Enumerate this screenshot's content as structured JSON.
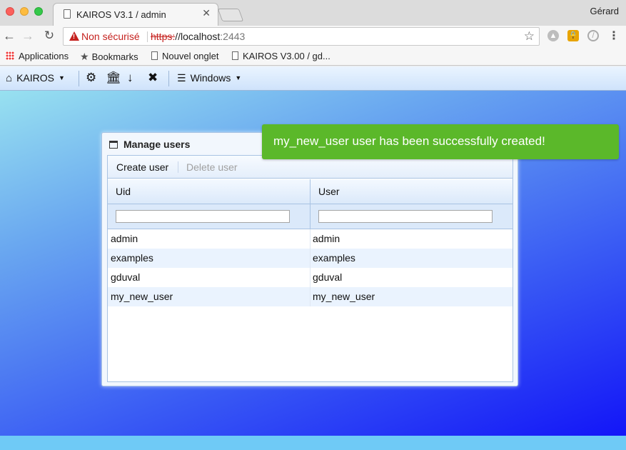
{
  "browser": {
    "tab_title": "KAIROS V3.1 / admin",
    "profile_name": "Gérard",
    "security_label": "Non sécurisé",
    "url_scheme": "https:",
    "url_host": "//localhost",
    "url_port": ":2443",
    "bookmarks": {
      "apps": "Applications",
      "bookmarks": "Bookmarks",
      "new_tab": "Nouvel onglet",
      "kairos": "KAIROS V3.00 / gd..."
    }
  },
  "app_menu": {
    "kairos_label": "KAIROS",
    "windows_label": "Windows",
    "icons": [
      "home-icon",
      "gear-icon",
      "bank-icon",
      "arrow-down-icon",
      "close-icon",
      "list-icon"
    ]
  },
  "dialog": {
    "title": "Manage users",
    "create_label": "Create user",
    "delete_label": "Delete user",
    "columns": [
      "Uid",
      "User"
    ],
    "filter_uid": "",
    "filter_user": "",
    "rows": [
      {
        "uid": "admin",
        "user": "admin"
      },
      {
        "uid": "examples",
        "user": "examples"
      },
      {
        "uid": "gduval",
        "user": "gduval"
      },
      {
        "uid": "my_new_user",
        "user": "my_new_user"
      }
    ]
  },
  "notification": {
    "message": "my_new_user user has been successfully created!",
    "color": "#5bb82a"
  }
}
